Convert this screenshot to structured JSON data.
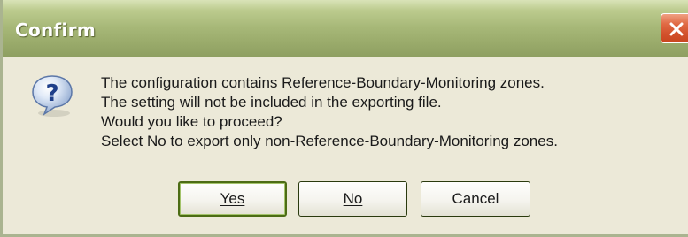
{
  "window": {
    "title": "Confirm",
    "close_icon": "close-icon",
    "accent_color": "#9aab6b",
    "close_color": "#d2512c"
  },
  "dialog": {
    "icon": "question-icon",
    "message_lines": [
      "The configuration contains Reference-Boundary-Monitoring zones.",
      "The setting will not be included in the exporting file.",
      "Would you like to proceed?",
      "Select No to export only non-Reference-Boundary-Monitoring zones."
    ]
  },
  "buttons": {
    "yes_label": "Yes",
    "no_label": "No",
    "cancel_label": "Cancel"
  }
}
